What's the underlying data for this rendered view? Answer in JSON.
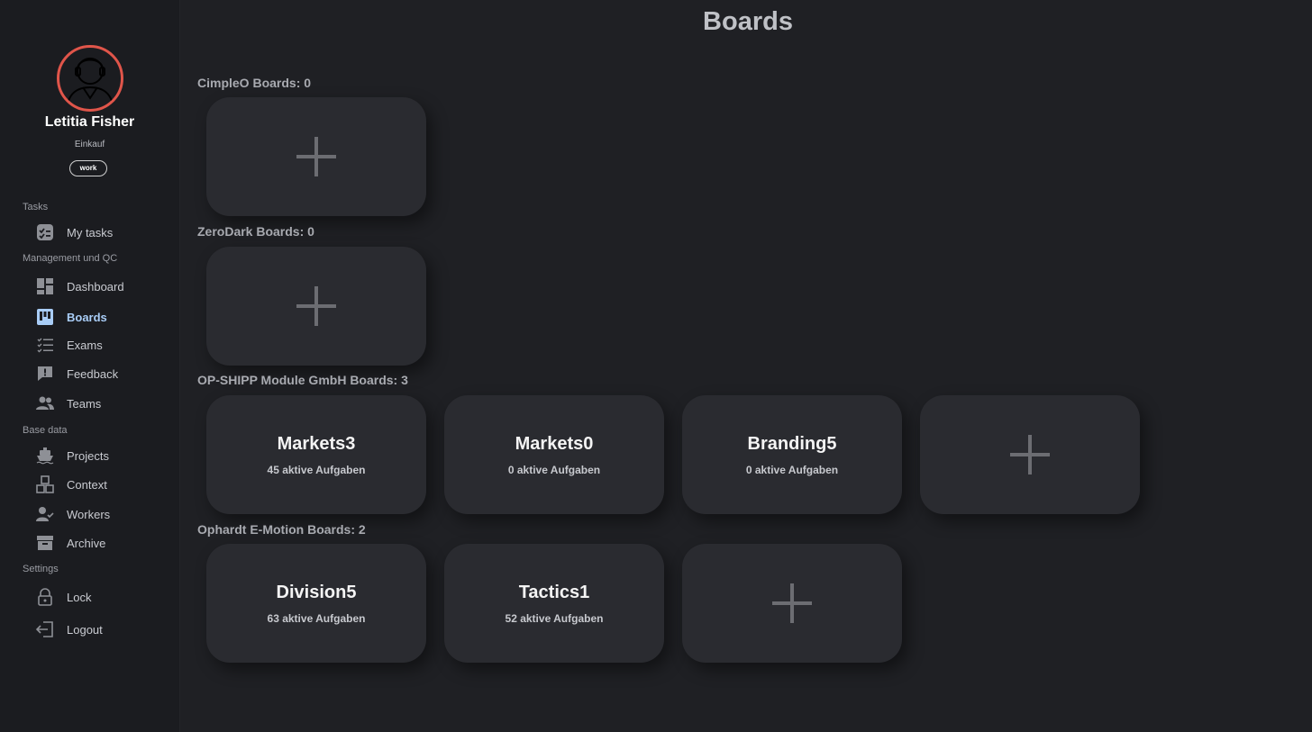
{
  "user": {
    "name": "Letitia Fisher",
    "department": "Einkauf",
    "tag": "work"
  },
  "sidebar": {
    "sections": [
      {
        "label": "Tasks"
      },
      {
        "label": "Management und QC"
      },
      {
        "label": "Base data"
      },
      {
        "label": "Settings"
      }
    ],
    "items": [
      {
        "label": "My tasks",
        "icon": "tasks-icon"
      },
      {
        "label": "Dashboard",
        "icon": "dashboard-icon"
      },
      {
        "label": "Boards",
        "icon": "boards-icon",
        "active": true
      },
      {
        "label": "Exams",
        "icon": "checklist-icon"
      },
      {
        "label": "Feedback",
        "icon": "feedback-icon"
      },
      {
        "label": "Teams",
        "icon": "people-icon"
      },
      {
        "label": "Projects",
        "icon": "ship-icon"
      },
      {
        "label": "Context",
        "icon": "cubes-icon"
      },
      {
        "label": "Workers",
        "icon": "user-check-icon"
      },
      {
        "label": "Archive",
        "icon": "archive-icon"
      },
      {
        "label": "Lock",
        "icon": "lock-icon"
      },
      {
        "label": "Logout",
        "icon": "logout-icon"
      }
    ]
  },
  "main": {
    "title": "Boards",
    "groups": [
      {
        "title": "CimpleO Boards: 0",
        "boards": []
      },
      {
        "title": "ZeroDark Boards: 0",
        "boards": []
      },
      {
        "title": "OP-SHIPP Module GmbH Boards: 3",
        "boards": [
          {
            "name": "Markets3",
            "sub": "45 aktive Aufgaben"
          },
          {
            "name": "Markets0",
            "sub": "0 aktive Aufgaben"
          },
          {
            "name": "Branding5",
            "sub": "0 aktive Aufgaben"
          }
        ]
      },
      {
        "title": "Ophardt E-Motion Boards: 2",
        "boards": [
          {
            "name": "Division5",
            "sub": "63 aktive Aufgaben"
          },
          {
            "name": "Tactics1",
            "sub": "52 aktive Aufgaben"
          }
        ]
      }
    ]
  },
  "colors": {
    "background": "#1f2024",
    "sidebar": "#1b1c20",
    "card": "#2a2b30",
    "active": "#a9cdf7",
    "avatar_ring": "#e0554a"
  }
}
